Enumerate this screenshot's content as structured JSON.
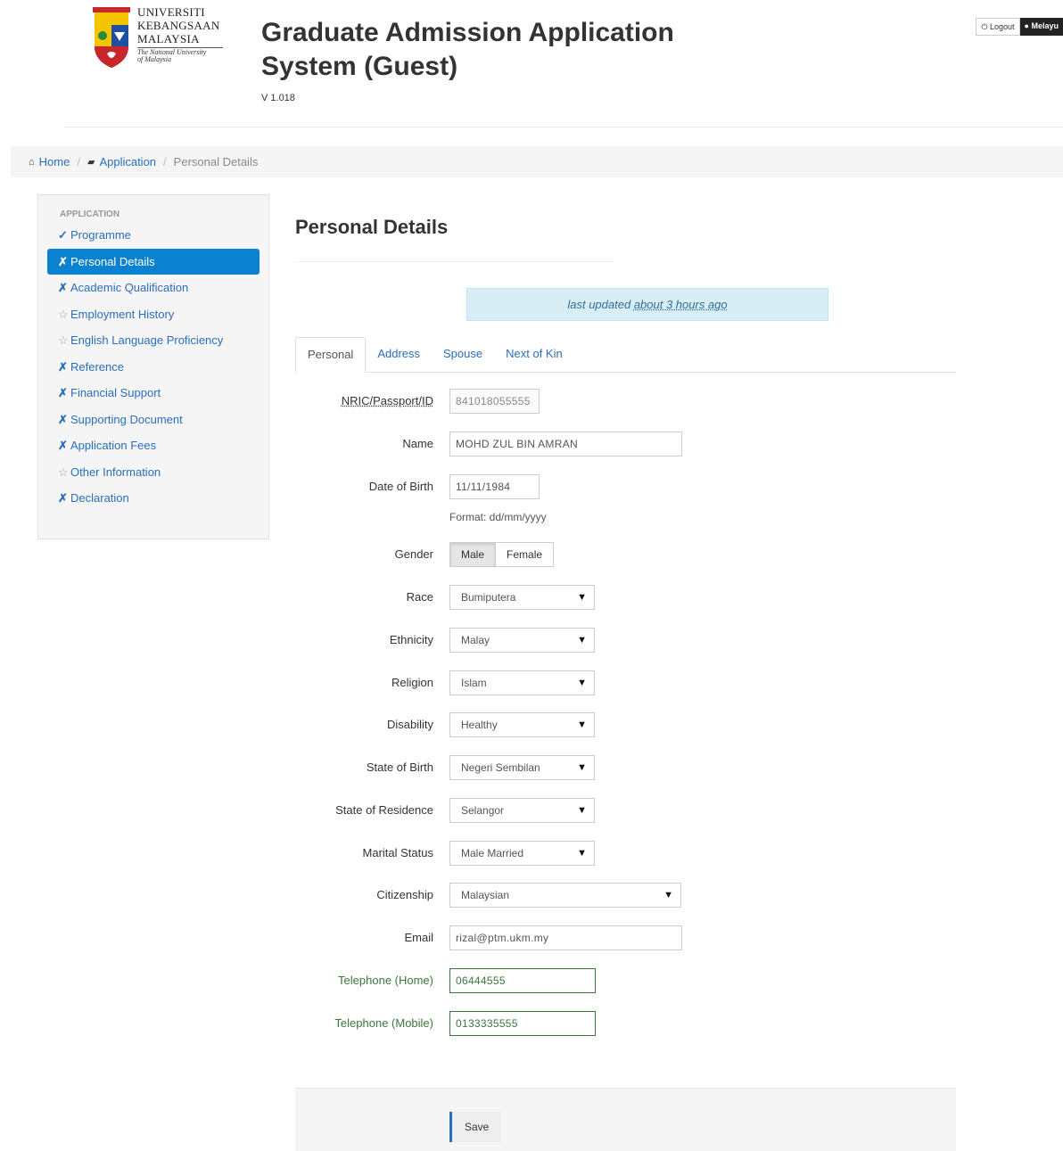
{
  "header": {
    "logo_lines": [
      "UNIVERSITI",
      "KEBANGSAAN",
      "MALAYSIA"
    ],
    "logo_tagline_1": "The National University",
    "logo_tagline_2": "of Malaysia",
    "title": "Graduate Admission Application System (Guest)",
    "version": "V 1.018",
    "logout_label": "Logout",
    "language_label": "Melayu"
  },
  "breadcrumb": {
    "home": "Home",
    "application": "Application",
    "current": "Personal Details"
  },
  "sidebar": {
    "header": "APPLICATION",
    "items": [
      {
        "mark": "✓",
        "label": "Programme"
      },
      {
        "mark": "✗",
        "label": "Personal Details"
      },
      {
        "mark": "✗",
        "label": "Academic Qualification"
      },
      {
        "mark": "☆",
        "label": "Employment History"
      },
      {
        "mark": "☆",
        "label": "English Language Proficiency"
      },
      {
        "mark": "✗",
        "label": "Reference"
      },
      {
        "mark": "✗",
        "label": "Financial Support"
      },
      {
        "mark": "✗",
        "label": "Supporting Document"
      },
      {
        "mark": "✗",
        "label": "Application Fees"
      },
      {
        "mark": "☆",
        "label": "Other Information"
      },
      {
        "mark": "✗",
        "label": "Declaration"
      }
    ]
  },
  "main": {
    "heading": "Personal Details",
    "alert_prefix": "last updated ",
    "alert_time": "about 3 hours ago",
    "tabs": [
      "Personal",
      "Address",
      "Spouse",
      "Next of Kin"
    ]
  },
  "form": {
    "nric_label": "NRIC/Passport/ID",
    "nric_value": "841018055555",
    "name_label": "Name",
    "name_value": "MOHD ZUL BIN AMRAN",
    "dob_label": "Date of Birth",
    "dob_value": "11/11/1984",
    "dob_help": "Format: dd/mm/yyyy",
    "gender_label": "Gender",
    "gender_male": "Male",
    "gender_female": "Female",
    "race_label": "Race",
    "race_value": "Bumiputera",
    "ethnicity_label": "Ethnicity",
    "ethnicity_value": "Malay",
    "religion_label": "Religion",
    "religion_value": "Islam",
    "disability_label": "Disability",
    "disability_value": "Healthy",
    "state_birth_label": "State of Birth",
    "state_birth_value": "Negeri Sembilan",
    "state_res_label": "State of Residence",
    "state_res_value": "Selangor",
    "marital_label": "Marital Status",
    "marital_value": "Male Married",
    "citizenship_label": "Citizenship",
    "citizenship_value": "Malaysian",
    "email_label": "Email",
    "email_value": "rizal@ptm.ukm.my",
    "tel_home_label": "Telephone (Home)",
    "tel_home_value": "06444555",
    "tel_mobile_label": "Telephone (Mobile)",
    "tel_mobile_value": "0133335555"
  },
  "actions": {
    "save_label": "Save"
  },
  "colors": {
    "link": "#2a6ebb",
    "active_nav": "#0b82cf",
    "alert_bg": "#d9edf7",
    "success": "#3c763d"
  }
}
